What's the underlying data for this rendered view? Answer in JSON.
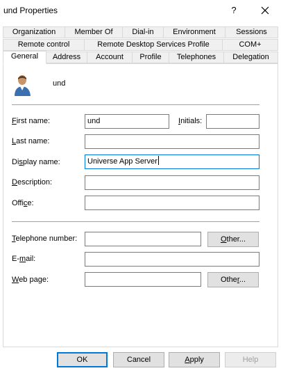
{
  "window": {
    "title": "und Properties",
    "help_label": "?",
    "close_label": "✕"
  },
  "tabs": {
    "row1": [
      "Organization",
      "Member Of",
      "Dial-in",
      "Environment",
      "Sessions"
    ],
    "row2": [
      "Remote control",
      "Remote Desktop Services Profile",
      "COM+"
    ],
    "row3": [
      "General",
      "Address",
      "Account",
      "Profile",
      "Telephones",
      "Delegation"
    ],
    "active": "General"
  },
  "general": {
    "user_name": "und",
    "first_name": {
      "label_first": "F",
      "label_rest": "irst name:",
      "value": "und"
    },
    "initials": {
      "label_first": "I",
      "label_rest": "nitials:",
      "value": ""
    },
    "last_name": {
      "label_first": "L",
      "label_rest": "ast name:",
      "value": ""
    },
    "display_name": {
      "label_pre": "Di",
      "label_ul": "s",
      "label_rest": "play name:",
      "value": "Universe App Server"
    },
    "description": {
      "label_first": "D",
      "label_rest": "escription:",
      "value": ""
    },
    "office": {
      "label_pre": "Offi",
      "label_ul": "c",
      "label_rest": "e:",
      "value": ""
    },
    "telephone": {
      "label_first": "T",
      "label_rest": "elephone number:",
      "value": "",
      "other_first": "O",
      "other_rest": "ther..."
    },
    "email": {
      "label_pre": "E-",
      "label_ul": "m",
      "label_rest": "ail:",
      "value": ""
    },
    "web_page": {
      "label_first": "W",
      "label_rest": "eb page:",
      "value": "",
      "other_pre": "Othe",
      "other_ul": "r",
      "other_rest": "..."
    }
  },
  "buttons": {
    "ok": "OK",
    "cancel": "Cancel",
    "apply_first": "A",
    "apply_rest": "pply",
    "help": "Help"
  }
}
